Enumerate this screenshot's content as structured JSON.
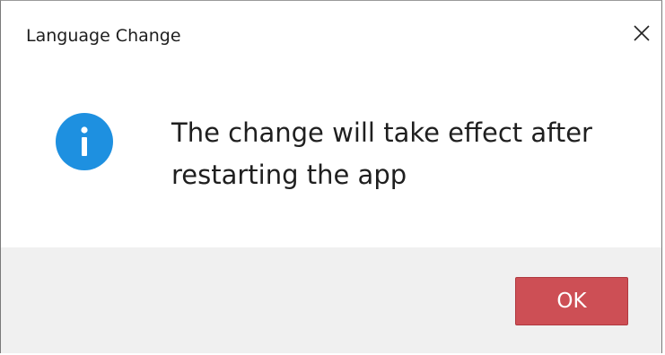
{
  "dialog": {
    "title": "Language Change",
    "close_icon": "close-icon",
    "info_icon": "info-icon",
    "info_icon_color": "#1e90e0",
    "message": "The change will take effect after restarting the app",
    "ok_label": "OK",
    "ok_color": "#cd4f55"
  }
}
